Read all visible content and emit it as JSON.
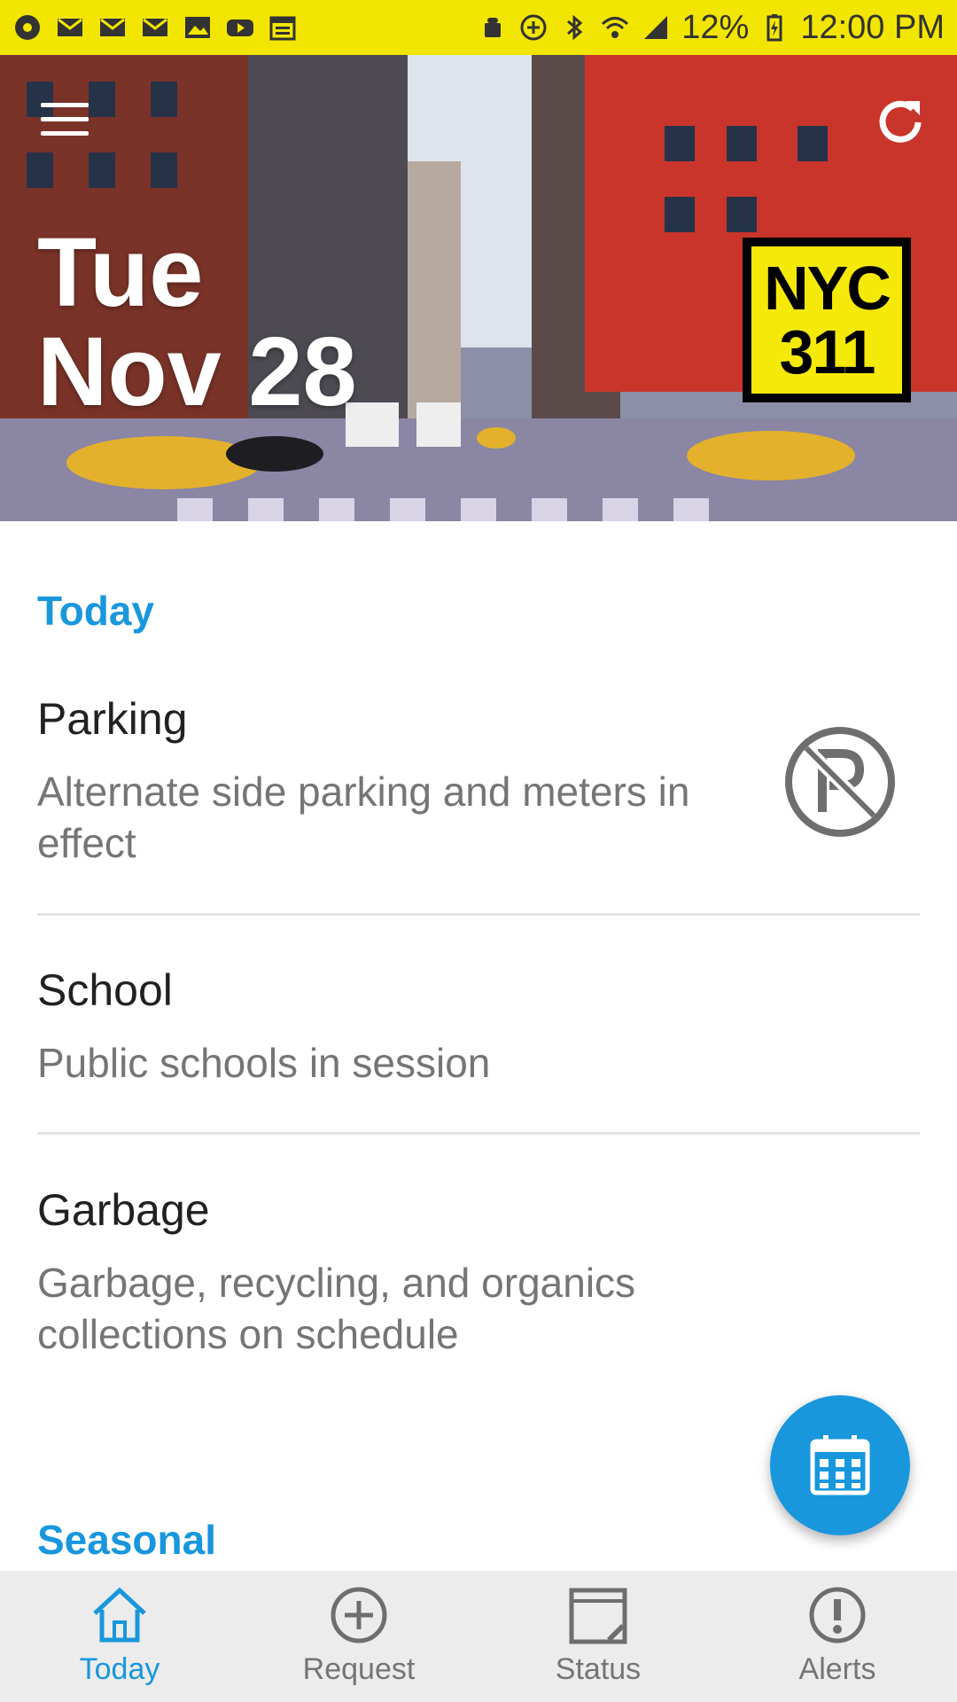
{
  "status_bar": {
    "battery": "12%",
    "time": "12:00 PM"
  },
  "hero": {
    "day": "Tue",
    "date": "Nov 28",
    "logo_line1": "NYC",
    "logo_line2": "311"
  },
  "today_section": {
    "title": "Today",
    "items": [
      {
        "title": "Parking",
        "description": "Alternate side parking and meters in effect",
        "icon": "no-parking-icon"
      },
      {
        "title": "School",
        "description": "Public schools in session"
      },
      {
        "title": "Garbage",
        "description": "Garbage, recycling, and organics collections on schedule"
      }
    ]
  },
  "seasonal_section": {
    "title": "Seasonal"
  },
  "bottom_nav": {
    "items": [
      {
        "label": "Today",
        "icon": "home-icon",
        "active": true
      },
      {
        "label": "Request",
        "icon": "plus-circle-icon",
        "active": false
      },
      {
        "label": "Status",
        "icon": "status-icon",
        "active": false
      },
      {
        "label": "Alerts",
        "icon": "alert-icon",
        "active": false
      }
    ]
  },
  "colors": {
    "status_bar": "#f2e600",
    "accent": "#1897dc",
    "logo_yellow": "#f5e90a"
  }
}
